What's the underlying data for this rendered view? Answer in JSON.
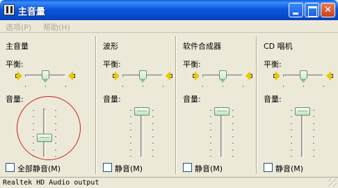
{
  "window": {
    "title": "主音量"
  },
  "menu": {
    "items": [
      {
        "label": "选项(P)"
      },
      {
        "label": "帮助(H)"
      }
    ]
  },
  "channels": [
    {
      "name": "主音量",
      "balance_label": "平衡:",
      "volume_label": "音量:",
      "mute_label": "全部静音(M)",
      "muted": false,
      "balance": 0.5,
      "volume": 0.35
    },
    {
      "name": "波形",
      "balance_label": "平衡:",
      "volume_label": "音量:",
      "mute_label": "静音(M)",
      "muted": false,
      "balance": 0.5,
      "volume": 1.0
    },
    {
      "name": "软件合成器",
      "balance_label": "平衡:",
      "volume_label": "音量:",
      "mute_label": "静音(M)",
      "muted": false,
      "balance": 0.5,
      "volume": 1.0
    },
    {
      "name": "CD 唱机",
      "balance_label": "平衡:",
      "volume_label": "音量:",
      "mute_label": "静音(M)",
      "muted": false,
      "balance": 0.5,
      "volume": 1.0
    }
  ],
  "status": {
    "device": "Realtek HD Audio output"
  },
  "colors": {
    "titlebar": "#0a58de",
    "window_bg": "#ece9d8",
    "highlight_circle": "#c0201a"
  }
}
